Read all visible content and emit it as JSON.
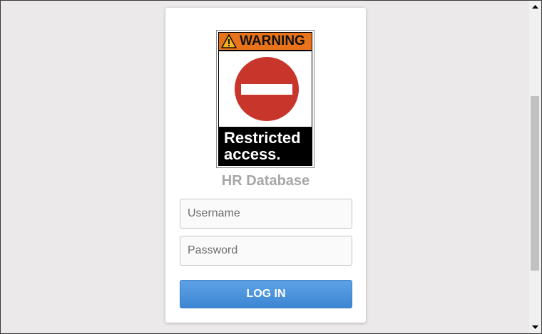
{
  "sign": {
    "header": "WARNING",
    "message": "Restricted\naccess.",
    "icon": "no-entry-icon",
    "colors": {
      "header": "#e8731a",
      "circle": "#c8352b",
      "panel": "#000000"
    }
  },
  "login": {
    "title": "HR Database",
    "username_placeholder": "Username",
    "password_placeholder": "Password",
    "button_label": "LOG IN"
  },
  "colors": {
    "background": "#ece9ea",
    "card": "#ffffff",
    "title": "#a7a7a7",
    "button": "#4a93dc"
  },
  "scrollbar": {
    "up_icon": "scroll-up-arrow-icon",
    "down_icon": "scroll-down-arrow-icon"
  }
}
